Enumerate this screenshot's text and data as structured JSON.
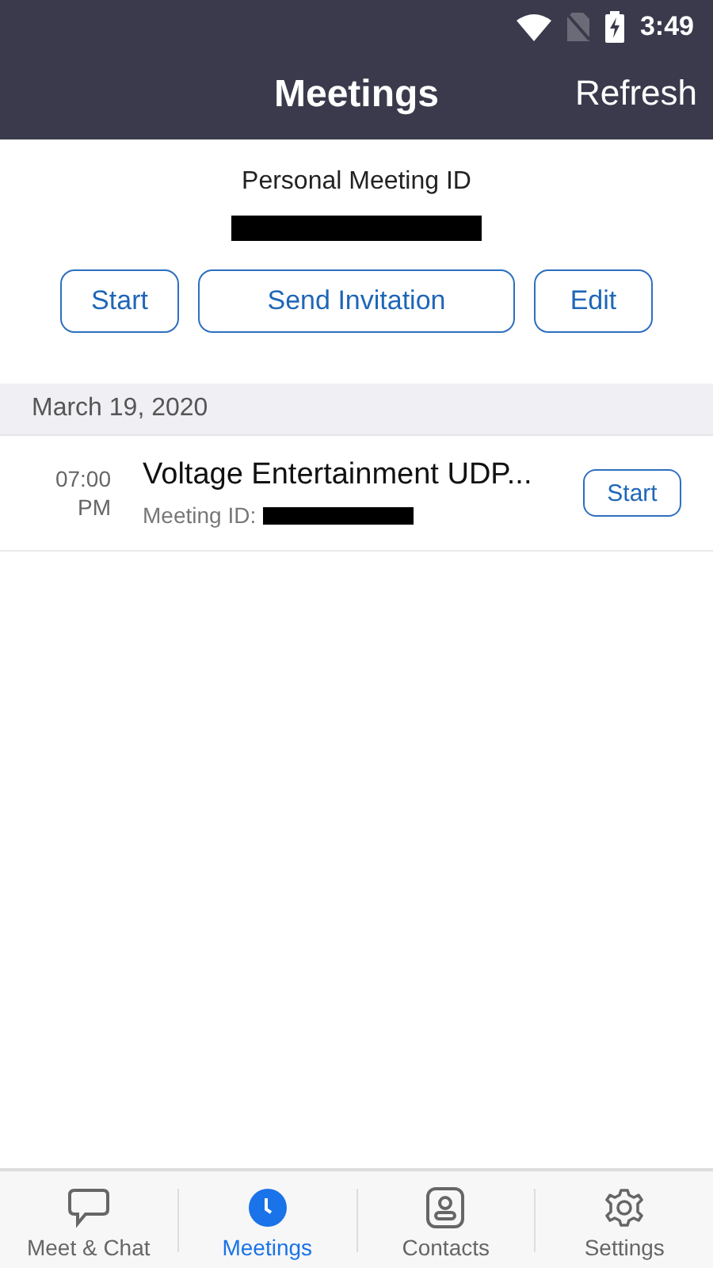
{
  "status_bar": {
    "time": "3:49"
  },
  "header": {
    "title": "Meetings",
    "action": "Refresh"
  },
  "personal": {
    "label": "Personal Meeting ID",
    "buttons": [
      "Start",
      "Send Invitation",
      "Edit"
    ]
  },
  "date_header": "March 19, 2020",
  "meetings": [
    {
      "time": "07:00",
      "period": "PM",
      "title": "Voltage Entertainment UDP...",
      "id_label": "Meeting ID:",
      "button": "Start"
    }
  ],
  "tabs": [
    {
      "label": "Meet & Chat",
      "kind": "chat",
      "selected": false
    },
    {
      "label": "Meetings",
      "kind": "clock",
      "selected": true
    },
    {
      "label": "Contacts",
      "kind": "contact",
      "selected": false
    },
    {
      "label": "Settings",
      "kind": "gear",
      "selected": false
    }
  ]
}
